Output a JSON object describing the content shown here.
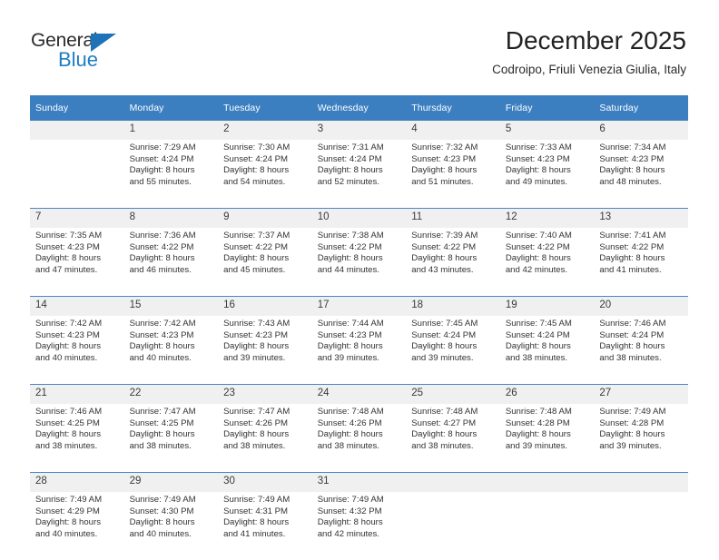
{
  "brand": {
    "name_top": "General",
    "name_bottom": "Blue",
    "accent_color": "#1d7ec4",
    "triangle_color": "#1d72b8"
  },
  "header": {
    "title": "December 2025",
    "subtitle": "Codroipo, Friuli Venezia Giulia, Italy"
  },
  "theme": {
    "header_row_bg": "#3c7fc1",
    "daynum_bg": "#f0f0f0",
    "week_rule": "#4a86c5",
    "body_bg": "#ffffff"
  },
  "weekday_headers": [
    "Sunday",
    "Monday",
    "Tuesday",
    "Wednesday",
    "Thursday",
    "Friday",
    "Saturday"
  ],
  "weeks": [
    {
      "days": [
        {
          "num": "",
          "l1": "",
          "l2": "",
          "l3": "",
          "l4": ""
        },
        {
          "num": "1",
          "l1": "Sunrise: 7:29 AM",
          "l2": "Sunset: 4:24 PM",
          "l3": "Daylight: 8 hours",
          "l4": "and 55 minutes."
        },
        {
          "num": "2",
          "l1": "Sunrise: 7:30 AM",
          "l2": "Sunset: 4:24 PM",
          "l3": "Daylight: 8 hours",
          "l4": "and 54 minutes."
        },
        {
          "num": "3",
          "l1": "Sunrise: 7:31 AM",
          "l2": "Sunset: 4:24 PM",
          "l3": "Daylight: 8 hours",
          "l4": "and 52 minutes."
        },
        {
          "num": "4",
          "l1": "Sunrise: 7:32 AM",
          "l2": "Sunset: 4:23 PM",
          "l3": "Daylight: 8 hours",
          "l4": "and 51 minutes."
        },
        {
          "num": "5",
          "l1": "Sunrise: 7:33 AM",
          "l2": "Sunset: 4:23 PM",
          "l3": "Daylight: 8 hours",
          "l4": "and 49 minutes."
        },
        {
          "num": "6",
          "l1": "Sunrise: 7:34 AM",
          "l2": "Sunset: 4:23 PM",
          "l3": "Daylight: 8 hours",
          "l4": "and 48 minutes."
        }
      ]
    },
    {
      "days": [
        {
          "num": "7",
          "l1": "Sunrise: 7:35 AM",
          "l2": "Sunset: 4:23 PM",
          "l3": "Daylight: 8 hours",
          "l4": "and 47 minutes."
        },
        {
          "num": "8",
          "l1": "Sunrise: 7:36 AM",
          "l2": "Sunset: 4:22 PM",
          "l3": "Daylight: 8 hours",
          "l4": "and 46 minutes."
        },
        {
          "num": "9",
          "l1": "Sunrise: 7:37 AM",
          "l2": "Sunset: 4:22 PM",
          "l3": "Daylight: 8 hours",
          "l4": "and 45 minutes."
        },
        {
          "num": "10",
          "l1": "Sunrise: 7:38 AM",
          "l2": "Sunset: 4:22 PM",
          "l3": "Daylight: 8 hours",
          "l4": "and 44 minutes."
        },
        {
          "num": "11",
          "l1": "Sunrise: 7:39 AM",
          "l2": "Sunset: 4:22 PM",
          "l3": "Daylight: 8 hours",
          "l4": "and 43 minutes."
        },
        {
          "num": "12",
          "l1": "Sunrise: 7:40 AM",
          "l2": "Sunset: 4:22 PM",
          "l3": "Daylight: 8 hours",
          "l4": "and 42 minutes."
        },
        {
          "num": "13",
          "l1": "Sunrise: 7:41 AM",
          "l2": "Sunset: 4:22 PM",
          "l3": "Daylight: 8 hours",
          "l4": "and 41 minutes."
        }
      ]
    },
    {
      "days": [
        {
          "num": "14",
          "l1": "Sunrise: 7:42 AM",
          "l2": "Sunset: 4:23 PM",
          "l3": "Daylight: 8 hours",
          "l4": "and 40 minutes."
        },
        {
          "num": "15",
          "l1": "Sunrise: 7:42 AM",
          "l2": "Sunset: 4:23 PM",
          "l3": "Daylight: 8 hours",
          "l4": "and 40 minutes."
        },
        {
          "num": "16",
          "l1": "Sunrise: 7:43 AM",
          "l2": "Sunset: 4:23 PM",
          "l3": "Daylight: 8 hours",
          "l4": "and 39 minutes."
        },
        {
          "num": "17",
          "l1": "Sunrise: 7:44 AM",
          "l2": "Sunset: 4:23 PM",
          "l3": "Daylight: 8 hours",
          "l4": "and 39 minutes."
        },
        {
          "num": "18",
          "l1": "Sunrise: 7:45 AM",
          "l2": "Sunset: 4:24 PM",
          "l3": "Daylight: 8 hours",
          "l4": "and 39 minutes."
        },
        {
          "num": "19",
          "l1": "Sunrise: 7:45 AM",
          "l2": "Sunset: 4:24 PM",
          "l3": "Daylight: 8 hours",
          "l4": "and 38 minutes."
        },
        {
          "num": "20",
          "l1": "Sunrise: 7:46 AM",
          "l2": "Sunset: 4:24 PM",
          "l3": "Daylight: 8 hours",
          "l4": "and 38 minutes."
        }
      ]
    },
    {
      "days": [
        {
          "num": "21",
          "l1": "Sunrise: 7:46 AM",
          "l2": "Sunset: 4:25 PM",
          "l3": "Daylight: 8 hours",
          "l4": "and 38 minutes."
        },
        {
          "num": "22",
          "l1": "Sunrise: 7:47 AM",
          "l2": "Sunset: 4:25 PM",
          "l3": "Daylight: 8 hours",
          "l4": "and 38 minutes."
        },
        {
          "num": "23",
          "l1": "Sunrise: 7:47 AM",
          "l2": "Sunset: 4:26 PM",
          "l3": "Daylight: 8 hours",
          "l4": "and 38 minutes."
        },
        {
          "num": "24",
          "l1": "Sunrise: 7:48 AM",
          "l2": "Sunset: 4:26 PM",
          "l3": "Daylight: 8 hours",
          "l4": "and 38 minutes."
        },
        {
          "num": "25",
          "l1": "Sunrise: 7:48 AM",
          "l2": "Sunset: 4:27 PM",
          "l3": "Daylight: 8 hours",
          "l4": "and 38 minutes."
        },
        {
          "num": "26",
          "l1": "Sunrise: 7:48 AM",
          "l2": "Sunset: 4:28 PM",
          "l3": "Daylight: 8 hours",
          "l4": "and 39 minutes."
        },
        {
          "num": "27",
          "l1": "Sunrise: 7:49 AM",
          "l2": "Sunset: 4:28 PM",
          "l3": "Daylight: 8 hours",
          "l4": "and 39 minutes."
        }
      ]
    },
    {
      "days": [
        {
          "num": "28",
          "l1": "Sunrise: 7:49 AM",
          "l2": "Sunset: 4:29 PM",
          "l3": "Daylight: 8 hours",
          "l4": "and 40 minutes."
        },
        {
          "num": "29",
          "l1": "Sunrise: 7:49 AM",
          "l2": "Sunset: 4:30 PM",
          "l3": "Daylight: 8 hours",
          "l4": "and 40 minutes."
        },
        {
          "num": "30",
          "l1": "Sunrise: 7:49 AM",
          "l2": "Sunset: 4:31 PM",
          "l3": "Daylight: 8 hours",
          "l4": "and 41 minutes."
        },
        {
          "num": "31",
          "l1": "Sunrise: 7:49 AM",
          "l2": "Sunset: 4:32 PM",
          "l3": "Daylight: 8 hours",
          "l4": "and 42 minutes."
        },
        {
          "num": "",
          "l1": "",
          "l2": "",
          "l3": "",
          "l4": ""
        },
        {
          "num": "",
          "l1": "",
          "l2": "",
          "l3": "",
          "l4": ""
        },
        {
          "num": "",
          "l1": "",
          "l2": "",
          "l3": "",
          "l4": ""
        }
      ]
    }
  ]
}
